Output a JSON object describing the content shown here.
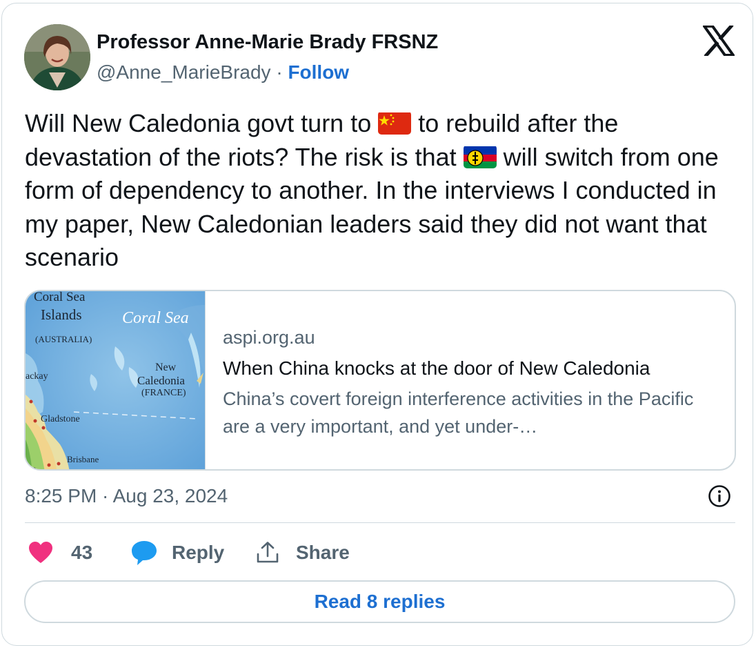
{
  "author": {
    "name": "Professor Anne-Marie Brady FRSNZ",
    "handle": "@Anne_MarieBrady",
    "separator": "·",
    "follow_label": "Follow"
  },
  "tweet": {
    "text_part1": "Will New Caledonia govt turn to ",
    "flag1": "china-flag-emoji",
    "text_part2": " to rebuild after the devastation of the riots? The risk is that ",
    "flag2": "new-caledonia-flag-emoji",
    "text_part3": " will switch from one form of dependency to another. In the interviews I conducted in my paper, New Caledonian leaders said they did not want that scenario"
  },
  "link_card": {
    "domain": "aspi.org.au",
    "title": "When China knocks at the door of New Caledonia",
    "description": "China’s covert foreign interference activities in the Pacific are a very important, and yet under-…",
    "map_labels": {
      "coral_sea": "Coral  Sea",
      "islands": "Islands",
      "australia": "(AUSTRALIA)",
      "coral_sea_italic": "Coral  Sea",
      "new": "New",
      "caledonia": "Caledonia",
      "france": "(FRANCE)",
      "mackay": "ackay",
      "gladstone": "Gladstone",
      "brisbane": "Brisbane",
      "ba": "ba"
    }
  },
  "timestamp": "8:25 PM · Aug 23, 2024",
  "actions": {
    "likes_count": "43",
    "reply_label": "Reply",
    "share_label": "Share"
  },
  "read_replies_label": "Read 8 replies",
  "colors": {
    "accent": "#1d6fd1",
    "heart": "#f0317f",
    "reply_bubble": "#1d9bf0",
    "secondary_text": "#536471",
    "border": "#cfd9de"
  }
}
